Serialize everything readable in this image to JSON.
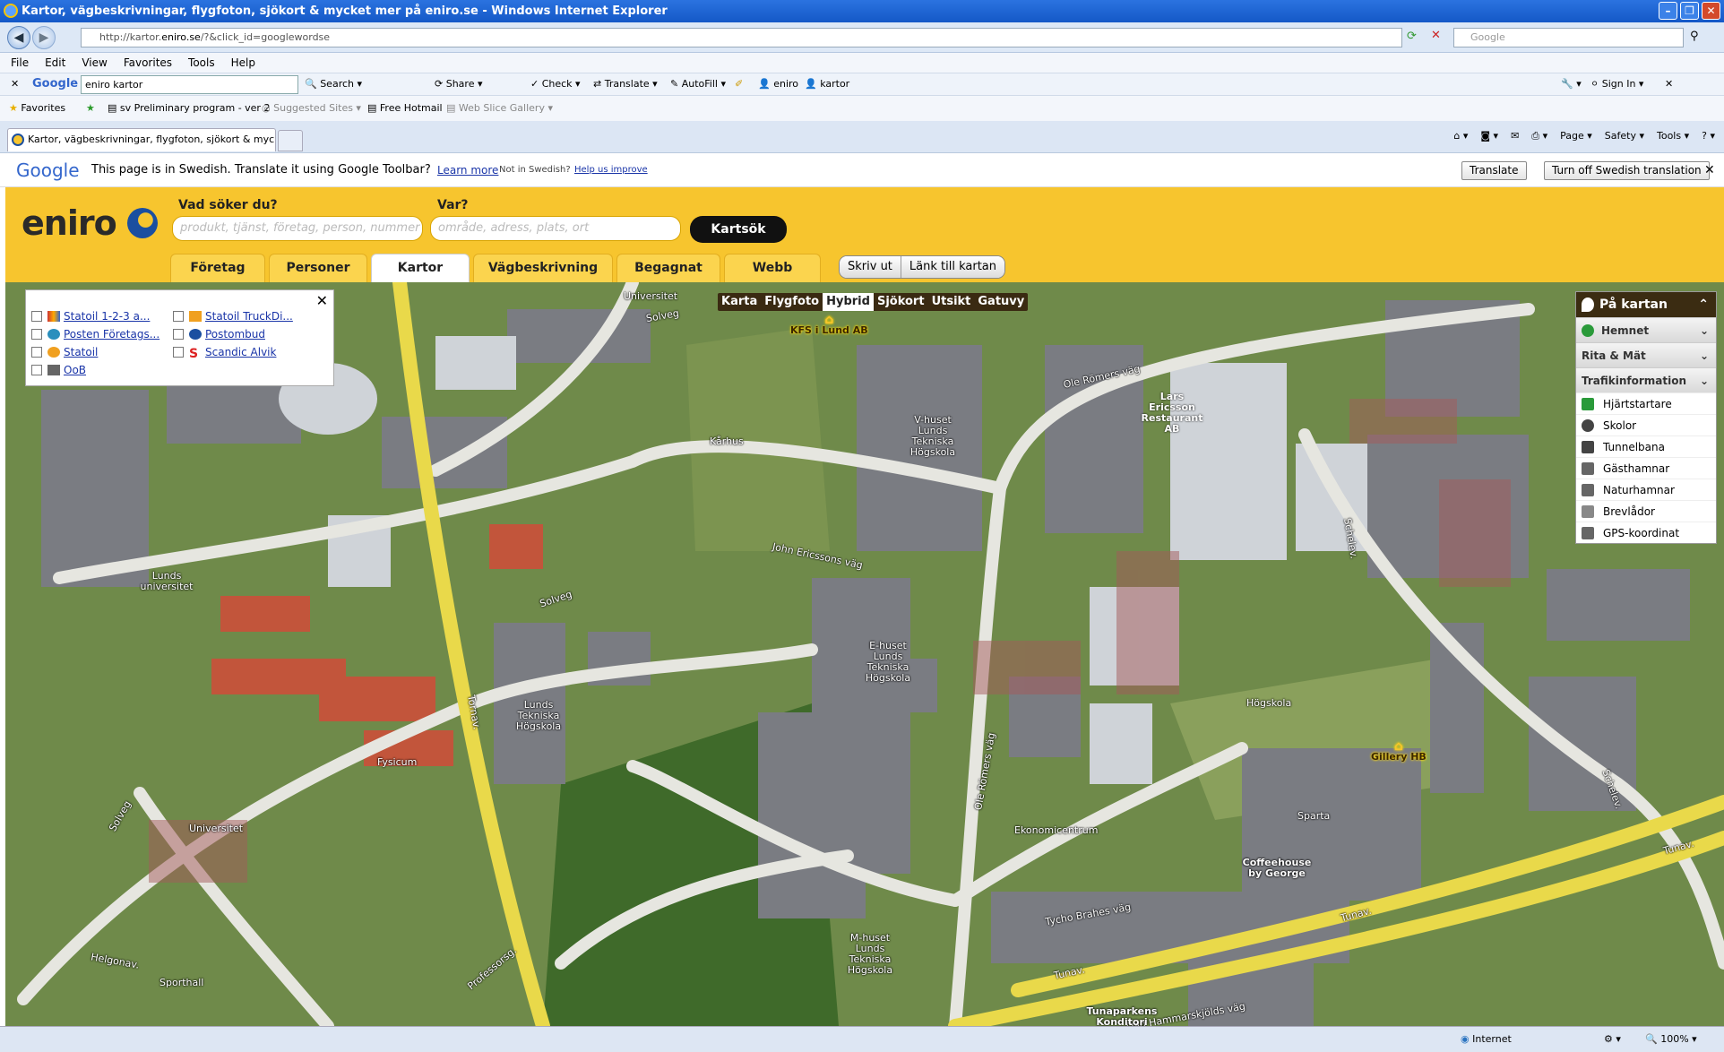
{
  "window": {
    "title": "Kartor, vägbeskrivningar, flygfoton, sjökort & mycket mer på eniro.se - Windows Internet Explorer"
  },
  "browser": {
    "url_prefix": "http://kartor.",
    "url_domain": "eniro.se",
    "url_suffix": "/?&click_id=googlewordse",
    "search_placeholder": "Google",
    "menu": [
      "File",
      "Edit",
      "View",
      "Favorites",
      "Tools",
      "Help"
    ],
    "toolbar": {
      "google_label": "Google",
      "google_query": "eniro kartor",
      "search": "Search",
      "share": "Share",
      "check": "Check",
      "translate": "Translate",
      "autofill": "AutoFill",
      "b1": "eniro",
      "b2": "kartor",
      "signin": "Sign In"
    },
    "favorites": {
      "label": "Favorites",
      "items": [
        "sv Preliminary program - ver 2",
        "Suggested Sites",
        "Free Hotmail",
        "Web Slice Gallery"
      ]
    },
    "tab_title": "Kartor, vägbeskrivningar, flygfoton, sjökort & mycket...",
    "command": [
      "Page",
      "Safety",
      "Tools"
    ],
    "status": {
      "zone": "Internet",
      "zoom": "100%"
    }
  },
  "translate_bar": {
    "brand": "Google",
    "message": "This page is in Swedish.  Translate it using Google Toolbar?",
    "learn_more": "Learn more",
    "not_swedish": "Not in Swedish?",
    "help": "Help us improve",
    "translate_btn": "Translate",
    "turn_off_btn": "Turn off Swedish translation"
  },
  "site": {
    "logo": "eniro",
    "what_label": "Vad söker du?",
    "what_placeholder": "produkt, tjänst, företag, person, nummer",
    "where_label": "Var?",
    "where_placeholder": "område, adress, plats, ort",
    "search_btn": "Kartsök",
    "tabs": [
      "Företag",
      "Personer",
      "Kartor",
      "Vägbeskrivning",
      "Begagnat",
      "Webb"
    ],
    "active_tab": "Kartor",
    "print_btn": "Skriv ut",
    "link_btn": "Länk till kartan"
  },
  "map": {
    "poi_items": [
      "Statoil 1-2-3 a...",
      "Posten Företags...",
      "Statoil",
      "OoB",
      "Statoil TruckDi...",
      "Postombud",
      "Scandic Alvik"
    ],
    "map_types": [
      "Karta",
      "Flygfoto",
      "Hybrid",
      "Sjökort",
      "Utsikt",
      "Gatuvy"
    ],
    "active_type": "Hybrid",
    "panel": {
      "title": "På kartan",
      "sections": [
        "Hemnet",
        "Rita & Mät",
        "Trafikinformation"
      ],
      "items": [
        "Hjärtstartare",
        "Skolor",
        "Tunnelbana",
        "Gästhamnar",
        "Naturhamnar",
        "Brevlådor",
        "GPS-koordinat"
      ]
    },
    "labels": {
      "universitet1": "Universitet",
      "solveg1": "Solveg",
      "karhus": "Kårhus",
      "vhuset": "V-huset Lunds Tekniska Högskola",
      "ole1": "Ole Römers väg",
      "john": "John Ericssons väg",
      "lunds_univ": "Lunds universitet",
      "solveg2": "Solveg",
      "ehuset": "E-huset Lunds Tekniska Högskola",
      "lth": "Lunds Tekniska Högskola",
      "tornav": "Tornav.",
      "fysicum": "Fysicum",
      "universitet2": "Universitet",
      "solveg3": "Solveg",
      "hogskola": "Högskola",
      "schelev1": "Schelev.",
      "schelev2": "Schelev.",
      "ole2": "Ole Römers väg",
      "ekonomi": "Ekonomicentrum",
      "sparta": "Sparta",
      "tunav1": "Tunav.",
      "tunav2": "Tunav.",
      "tunav3": "Tunav.",
      "tycho": "Tycho Brahes väg",
      "mhuset": "M-huset Lunds Tekniska Högskola",
      "helgonav": "Helgonav.",
      "sporthall": "Sporthall",
      "professorsg": "Professorsg.",
      "dag": "Dag Hammarskjölds väg",
      "kfs": "KFS i Lund AB",
      "lars": "Lars Ericsson Restaurant AB",
      "gillery": "Gillery HB",
      "coffee": "Coffeehouse by George",
      "tunaparken": "Tunaparkens Konditori"
    }
  }
}
